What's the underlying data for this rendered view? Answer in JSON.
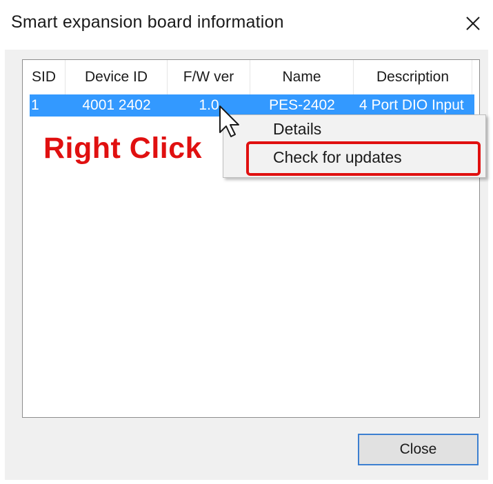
{
  "window": {
    "title": "Smart expansion board information",
    "close_icon": "close-icon"
  },
  "table": {
    "columns": [
      "SID",
      "Device ID",
      "F/W ver",
      "Name",
      "Description"
    ],
    "rows": [
      {
        "sid": "1",
        "device_id": "4001 2402",
        "fw_ver": "1.0",
        "name": "PES-2402",
        "description": "4 Port DIO Input"
      }
    ],
    "selected_row_color": "#3399ff"
  },
  "annotation": {
    "text": "Right Click",
    "color": "#e01010"
  },
  "context_menu": {
    "items": [
      "Details",
      "Check for updates"
    ],
    "highlighted_item": "Check for updates"
  },
  "footer": {
    "close_label": "Close"
  }
}
